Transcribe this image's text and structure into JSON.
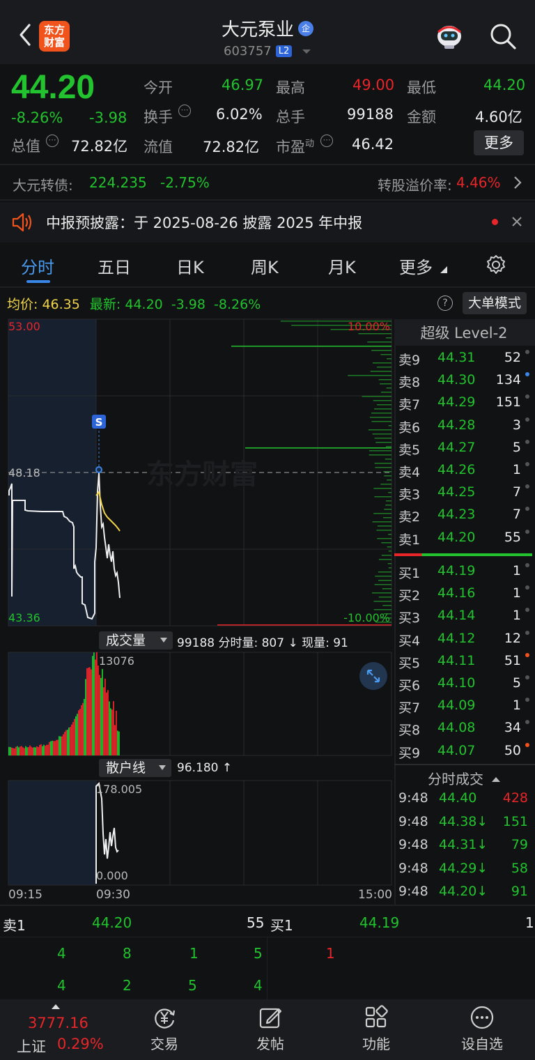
{
  "header": {
    "logo": "东方\n财富",
    "logo_line1": "东方",
    "logo_line2": "财富",
    "title": "大元泵业",
    "badge": "企",
    "code": "603757",
    "level": "L2"
  },
  "quote": {
    "price": "44.20",
    "change_pct": "-8.26%",
    "change": "-3.98",
    "open_label": "今开",
    "open": "46.97",
    "high_label": "最高",
    "high": "49.00",
    "low_label": "最低",
    "low": "44.20",
    "turnover_label": "换手",
    "turnover": "6.02%",
    "volume_label": "总手",
    "volume": "99188",
    "amount_label": "金额",
    "amount": "4.60亿",
    "mktcap_label": "总值",
    "mktcap": "72.82亿",
    "float_label": "流值",
    "float": "72.82亿",
    "pe_label": "市盈",
    "pe_sup": "动",
    "pe": "46.42",
    "more": "更多"
  },
  "bond": {
    "label": "大元转债:",
    "price": "224.235",
    "change": "-2.75%",
    "premium_label": "转股溢价率:",
    "premium": "4.46%"
  },
  "notice": {
    "text": "中报预披露：于 2025-08-26 披露 2025 年中报"
  },
  "tabs": [
    "分时",
    "五日",
    "日K",
    "周K",
    "月K",
    "更多"
  ],
  "chart": {
    "avg_label": "均价:",
    "avg": "46.35",
    "latest_label": "最新:",
    "latest": "44.20",
    "latest_change": "-3.98",
    "latest_pct": "-8.26%",
    "big_order": "大单模式",
    "y_top": "53.00",
    "y_mid": "48.18",
    "y_bot": "43.36",
    "pct_top": "10.00%",
    "pct_bot": "-10.00%",
    "marker": "S",
    "watermark": "东方财富",
    "vol_label": "成交量",
    "vol_text": "99188 分时量: 807 ↓ 现量: 91",
    "vol_max": "13076",
    "retail_label": "散户线",
    "retail_text": "96.180 ↑",
    "retail_max": "178.005",
    "retail_min": "0.000",
    "t_start": "09:15",
    "t_open": "09:30",
    "t_end": "15:00"
  },
  "level2": {
    "title": "超级 Level-2",
    "asks": [
      {
        "label": "卖9",
        "price": "44.31",
        "vol": "52"
      },
      {
        "label": "卖8",
        "price": "44.30",
        "vol": "134",
        "dot": "#3d86e8"
      },
      {
        "label": "卖7",
        "price": "44.29",
        "vol": "151"
      },
      {
        "label": "卖6",
        "price": "44.28",
        "vol": "3"
      },
      {
        "label": "卖5",
        "price": "44.27",
        "vol": "5"
      },
      {
        "label": "卖4",
        "price": "44.26",
        "vol": "1"
      },
      {
        "label": "卖3",
        "price": "44.25",
        "vol": "7"
      },
      {
        "label": "卖2",
        "price": "44.23",
        "vol": "7"
      },
      {
        "label": "卖1",
        "price": "44.20",
        "vol": "55"
      }
    ],
    "bids": [
      {
        "label": "买1",
        "price": "44.19",
        "vol": "1"
      },
      {
        "label": "买2",
        "price": "44.16",
        "vol": "1"
      },
      {
        "label": "买3",
        "price": "44.14",
        "vol": "1"
      },
      {
        "label": "买4",
        "price": "44.12",
        "vol": "12"
      },
      {
        "label": "买5",
        "price": "44.11",
        "vol": "51",
        "dot": "#f0531c"
      },
      {
        "label": "买6",
        "price": "44.10",
        "vol": "5"
      },
      {
        "label": "买7",
        "price": "44.09",
        "vol": "1"
      },
      {
        "label": "买8",
        "price": "44.08",
        "vol": "34"
      },
      {
        "label": "买9",
        "price": "44.07",
        "vol": "50",
        "dot": "#f0531c"
      }
    ],
    "tape_title": "分时成交",
    "tape": [
      {
        "time": "9:48",
        "price": "44.40",
        "vol": "428",
        "price_color": "#22c32e",
        "vol_color": "#e8262a"
      },
      {
        "time": "9:48",
        "price": "44.38↓",
        "vol": "151",
        "price_color": "#22c32e",
        "vol_color": "#22c32e"
      },
      {
        "time": "9:48",
        "price": "44.31↓",
        "vol": "79",
        "price_color": "#22c32e",
        "vol_color": "#22c32e"
      },
      {
        "time": "9:48",
        "price": "44.29↓",
        "vol": "58",
        "price_color": "#22c32e",
        "vol_color": "#22c32e"
      },
      {
        "time": "9:48",
        "price": "44.20↓",
        "vol": "91",
        "price_color": "#22c32e",
        "vol_color": "#22c32e"
      }
    ]
  },
  "queue": {
    "ask_label": "卖1",
    "ask_price": "44.20",
    "ask_vol": "55",
    "bid_label": "买1",
    "bid_price": "44.19",
    "bid_vol": "1",
    "ask_row1": [
      "4",
      "8",
      "1",
      "5"
    ],
    "ask_row2": [
      "4",
      "2",
      "5",
      "4"
    ],
    "bid_row1": [
      "1"
    ]
  },
  "bottom_nav": {
    "index_value": "3777.16",
    "index_name": "上证",
    "index_pct": "0.29%",
    "items": [
      "交易",
      "发帖",
      "功能",
      "设自选"
    ]
  },
  "colors": {
    "up": "#e8262a",
    "down": "#22c32e",
    "avg": "#f2d44a",
    "accent": "#3a86e8"
  }
}
